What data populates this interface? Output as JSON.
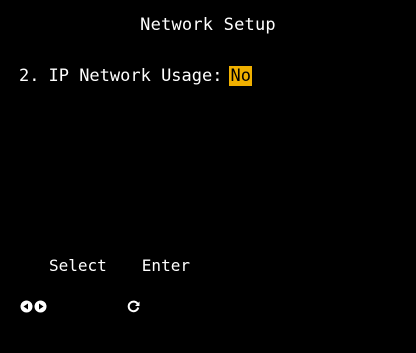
{
  "screen": {
    "title": "Network Setup",
    "background": "#000000",
    "text_color": "#ffffff"
  },
  "menu": {
    "items": [
      {
        "number": "2.",
        "label": "IP Network Usage:",
        "value": "No",
        "highlight_color": "#f0b000"
      }
    ]
  },
  "footer": {
    "left_icon": "left-arrow-circle-icon",
    "right_icon": "right-arrow-circle-icon",
    "select_label": "Select",
    "enter_icon": "enter-circle-arrow-icon",
    "enter_label": "Enter"
  }
}
